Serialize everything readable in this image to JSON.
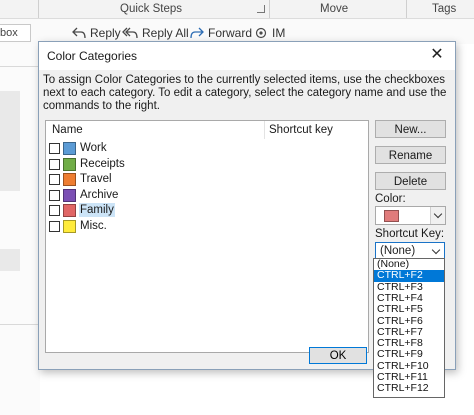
{
  "ribbon": {
    "group_quick_steps": "Quick Steps",
    "group_move": "Move",
    "group_tags": "Tags",
    "actions": [
      {
        "label": "Reply",
        "icon": "reply-icon"
      },
      {
        "label": "Reply All",
        "icon": "reply-all-icon"
      },
      {
        "label": "Forward",
        "icon": "forward-icon"
      },
      {
        "label": "IM",
        "icon": "im-icon"
      }
    ]
  },
  "left": {
    "field_text": "box"
  },
  "dialog": {
    "title": "Color Categories",
    "instructions": "To assign Color Categories to the currently selected items, use the checkboxes next to each category.  To edit a category, select the category name and use the commands to the right.",
    "columns": {
      "name": "Name",
      "shortcut": "Shortcut key"
    },
    "categories": [
      {
        "name": "Work",
        "color": "#5b9bd5",
        "checked": false
      },
      {
        "name": "Receipts",
        "color": "#70ad47",
        "checked": false
      },
      {
        "name": "Travel",
        "color": "#ed7d31",
        "checked": false
      },
      {
        "name": "Archive",
        "color": "#7b4fb4",
        "checked": false
      },
      {
        "name": "Family",
        "color": "#e06666",
        "checked": false,
        "selected": true
      },
      {
        "name": "Misc.",
        "color": "#ffeb3b",
        "checked": false
      }
    ],
    "buttons": {
      "new": "New...",
      "rename": "Rename",
      "delete": "Delete",
      "ok": "OK"
    },
    "color_label": "Color:",
    "current_color": "#e07b7b",
    "shortcut_label": "Shortcut Key:",
    "shortcut_value": "(None)",
    "shortcut_options": [
      "(None)",
      "CTRL+F2",
      "CTRL+F3",
      "CTRL+F4",
      "CTRL+F5",
      "CTRL+F6",
      "CTRL+F7",
      "CTRL+F8",
      "CTRL+F9",
      "CTRL+F10",
      "CTRL+F11",
      "CTRL+F12"
    ],
    "highlighted_option": "CTRL+F2"
  }
}
